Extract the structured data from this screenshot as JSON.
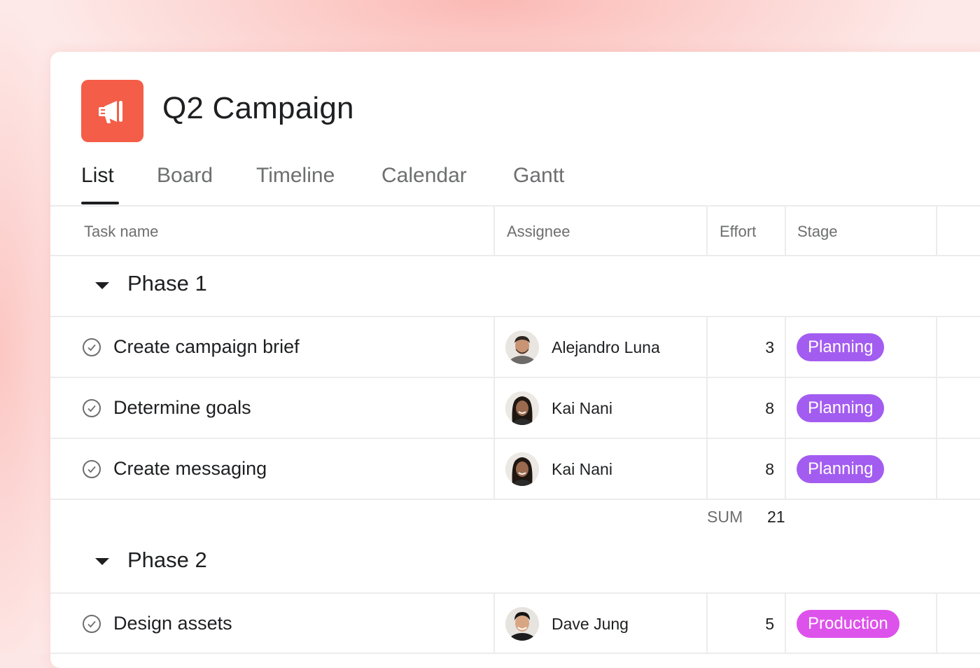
{
  "project": {
    "title": "Q2 Campaign",
    "icon": "megaphone-icon",
    "icon_color": "#f45d48"
  },
  "tabs": [
    {
      "label": "List",
      "active": true
    },
    {
      "label": "Board",
      "active": false
    },
    {
      "label": "Timeline",
      "active": false
    },
    {
      "label": "Calendar",
      "active": false
    },
    {
      "label": "Gantt",
      "active": false
    }
  ],
  "columns": [
    "Task name",
    "Assignee",
    "Effort",
    "Stage"
  ],
  "groups": [
    {
      "title": "Phase 1",
      "tasks": [
        {
          "name": "Create campaign brief",
          "assignee": "Alejandro Luna",
          "effort": "3",
          "stage": "Planning"
        },
        {
          "name": "Determine goals",
          "assignee": "Kai Nani",
          "effort": "8",
          "stage": "Planning"
        },
        {
          "name": "Create messaging",
          "assignee": "Kai Nani",
          "effort": "8",
          "stage": "Planning"
        }
      ],
      "sum_label": "SUM",
      "sum_value": "21"
    },
    {
      "title": "Phase 2",
      "tasks": [
        {
          "name": "Design assets",
          "assignee": "Dave Jung",
          "effort": "5",
          "stage": "Production"
        }
      ]
    }
  ],
  "stage_colors": {
    "Planning": "#a35cf0",
    "Production": "#de52ec"
  }
}
